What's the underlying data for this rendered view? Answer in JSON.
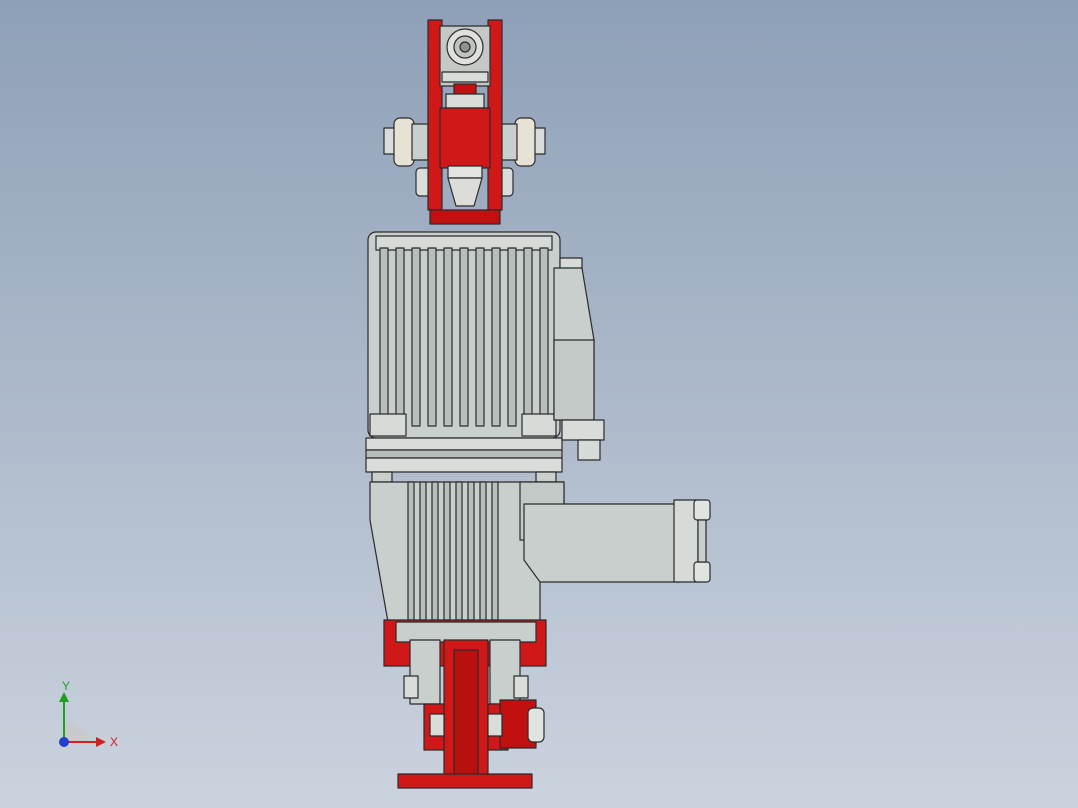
{
  "viewport": {
    "background_top": "#8ea0b8",
    "background_bottom": "#cbd3de"
  },
  "model": {
    "primary_color": "#d01818",
    "housing_color": "#c9cfcc",
    "edge_color": "#2b2b2b",
    "parts": [
      "top-clevis",
      "motor-housing",
      "terminal-box",
      "pump-body",
      "side-flange",
      "base-clevis"
    ]
  },
  "triad": {
    "x_label": "X",
    "y_label": "Y",
    "x_color": "#d42020",
    "y_color": "#20a020",
    "z_color": "#2040d0"
  }
}
